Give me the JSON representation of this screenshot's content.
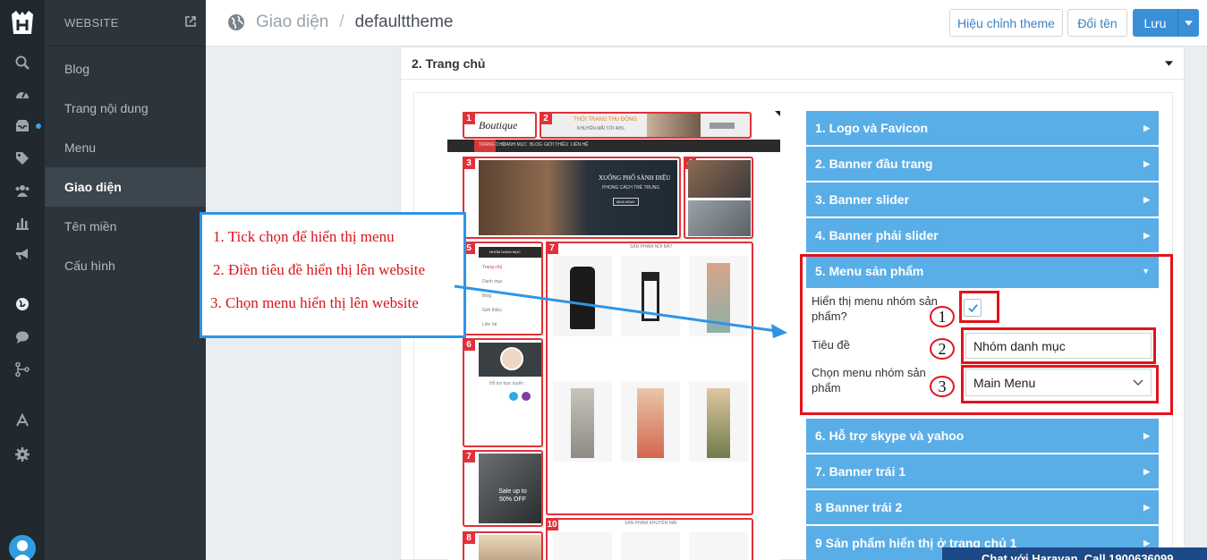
{
  "sidebar": {
    "header": "WEBSITE",
    "items": [
      {
        "label": "Blog"
      },
      {
        "label": "Trang nội dung"
      },
      {
        "label": "Menu"
      },
      {
        "label": "Giao diện"
      },
      {
        "label": "Tên miền"
      },
      {
        "label": "Cấu hình"
      }
    ],
    "active_index": 3
  },
  "header": {
    "breadcrumb_parent": "Giao diện",
    "breadcrumb_separator": "/",
    "breadcrumb_current": "defaulttheme",
    "btn_edit_theme": "Hiệu chỉnh theme",
    "btn_rename": "Đổi tên",
    "btn_save": "Lưu"
  },
  "section": {
    "title": "2. Trang chủ"
  },
  "preview": {
    "zones": [
      "1",
      "2",
      "3",
      "4",
      "5",
      "6",
      "7",
      "8",
      "10",
      "8"
    ],
    "nav_items": [
      "TRANG CHỦ",
      "DANH MỤC",
      "BLOG",
      "GIỚI THIỆU",
      "LIÊN HỆ"
    ],
    "banner_top_line1": "THỜI TRANG THU ĐÔNG",
    "banner_top_line2": "KHUYẾN MÃI TỚI 40%",
    "slider_line1": "XUỐNG PHỐ SÀNH ĐIỆU",
    "slider_line2": "PHONG CÁCH TRẺ TRUNG",
    "slider_button": "MUA NGAY",
    "menu_group_title": "NHÓM DANH MỤC",
    "menu_group_items": [
      "Trang chủ",
      "Danh mục",
      "Blog",
      "Giới thiệu",
      "Liên hệ"
    ],
    "featured_title": "SẢN PHẨM NỔI BẬT",
    "promo_title": "SẢN PHẨM KHUYẾN MÃI",
    "support_title": "Hỗ trợ trực tuyến",
    "left_banner_text": "Sale up to 50% OFF",
    "logo_text": "Boutique"
  },
  "accordion": [
    {
      "label": "1. Logo và Favicon"
    },
    {
      "label": "2. Banner đầu trang"
    },
    {
      "label": "3. Banner slider"
    },
    {
      "label": "4. Banner phải slider"
    },
    {
      "label": "5. Menu sản phẩm"
    },
    {
      "label": "6. Hỗ trợ skype và yahoo"
    },
    {
      "label": "7. Banner trái 1"
    },
    {
      "label": "8 Banner trái 2"
    },
    {
      "label": "9 Sản phẩm hiển thị ở trang chủ 1"
    }
  ],
  "menu_form": {
    "show_menu_label": "Hiển thị menu nhóm sản phẩm?",
    "show_menu_checked": true,
    "title_label": "Tiêu đề",
    "title_value": "Nhóm danh mục",
    "choose_menu_label": "Chọn menu nhóm sản phẩm",
    "choose_menu_value": "Main Menu"
  },
  "annotations": {
    "markers": [
      "1",
      "2",
      "3"
    ],
    "callout_lines": [
      "1. Tick chọn để hiển thị menu",
      "2. Điền tiêu đề hiển thị lên website",
      "3. Chọn menu hiển thị lên website"
    ],
    "accent_red": "#e3131b",
    "accent_blue": "#2e95e6"
  },
  "chat": {
    "label": "Chat với Haravan. Call 1900636099"
  },
  "colors": {
    "rail": "#21282e",
    "sidebar": "#2d353c",
    "accordion": "#5aaee7",
    "primary_button": "#3a8fd6"
  }
}
